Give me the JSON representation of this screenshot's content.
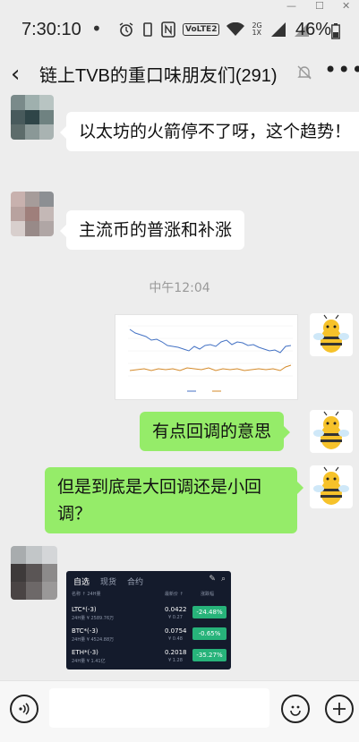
{
  "status_bar": {
    "time": "7:30:10",
    "dot": "•",
    "volte": "VoLTE2",
    "network": "2G 1X",
    "battery": "46%"
  },
  "header": {
    "back": "‹",
    "title": "链上TVB的重口味朋友们(291)",
    "more": "•••"
  },
  "messages": [
    {
      "side": "left",
      "text": "以太坊的火箭停不了呀，这个趋势！"
    },
    {
      "side": "left",
      "text": "主流币的普涨和补涨"
    },
    {
      "side": "right",
      "text": "有点回调的意思"
    },
    {
      "side": "right",
      "text": "但是到底是大回调还是小回调？"
    }
  ],
  "timestamp": "中午12:04",
  "stock_panel": {
    "tabs": [
      "自选",
      "现货",
      "合约"
    ],
    "header_cols": [
      "名称 ↑ 24H量",
      "最新价 ↑",
      "涨跌幅"
    ],
    "rows": [
      {
        "name": "LTC*(-3)",
        "sub": "24H量 ¥ 2589.76万",
        "price": "0.0422",
        "sub_price": "¥ 0.27",
        "change": "-24.48%"
      },
      {
        "name": "BTC*(-3)",
        "sub": "24H量 ¥ 4524.88万",
        "price": "0.0754",
        "sub_price": "¥ 0.48",
        "change": "-0.65%"
      },
      {
        "name": "ETH*(-3)",
        "sub": "24H量 ¥ 1.41亿",
        "price": "0.2018",
        "sub_price": "¥ 1.28",
        "change": "-35.27%"
      }
    ]
  },
  "colors": {
    "background": "#ededed",
    "bubble_right": "#95ec69",
    "bubble_left": "#ffffff",
    "change_badge": "#27b37a"
  },
  "icons": {
    "voice": "voice-icon",
    "emoji": "emoji-icon",
    "add": "add-icon",
    "mute": "mute-bell-icon",
    "back": "back-arrow-icon"
  }
}
